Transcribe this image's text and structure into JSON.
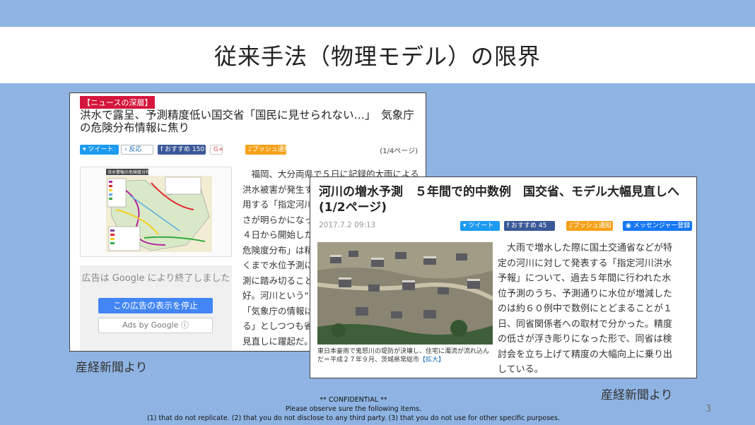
{
  "slide": {
    "title": "従来手法（物理モデル）の限界",
    "page_number": "3"
  },
  "article1": {
    "tag": "【ニュースの深層】",
    "headline": "洪水で露呈、予測精度低い国交省「国民に見せられない…」　気象庁の危険分布情報に焦り",
    "share": {
      "tweet": "ツイート",
      "react": "反応",
      "fb": "おすすめ 150",
      "gplus": "G+",
      "push": "プッシュ通知"
    },
    "page_indicator": "(1/4ページ)",
    "map_label": "洪水警報の危険度分布",
    "ad": {
      "text": "広告は Google により終了しました",
      "stop": "この広告の表示を停止",
      "by": "Ads by Google ⓘ"
    },
    "body": [
      "　福岡、大分両県で５日に記録的大雨による",
      "洪水被害が発生す",
      "用する「指定河川",
      "さが明らかになっ",
      "４日から開始した",
      "危険度分布」は精",
      "くまで水位予測に",
      "測に踏み切ること",
      "好。河川という“聖",
      "「気象庁の情報は",
      "る」としつつも省",
      "見直しに躍起だ。"
    ],
    "source": "産経新聞より"
  },
  "article2": {
    "headline": "河川の増水予測　５年間で的中数例　国交省、モデル大幅見直しへ (1/2ページ)",
    "date": "2017.7.2 09:13",
    "share": {
      "tweet": "ツイート",
      "fb": "おすすめ 45",
      "push": "プッシュ通知",
      "messenger": "メッセンジャー登録"
    },
    "caption": "東日本豪雨で鬼怒川の堤防が決壊し、住宅に濁流が流れ込んだ＝平成２７年９月、茨城県常総市",
    "enlarge": "【拡大】",
    "body": [
      "　大雨で増水した際に国土交通省などが特",
      "定の河川に対して発表する「指定河川洪水",
      "予報」について、過去５年間に行われた水",
      "位予測のうち、予測通りに水位が増減した",
      "のは約６０例中で数例にとどまることが１",
      "日、同省関係者への取材で分かった。精度",
      "の低さが浮き彫りになった形で、同省は検",
      "討会を立ち上げて精度の大幅向上に乗り出",
      "している。"
    ],
    "source": "産経新聞より"
  },
  "footer": {
    "line1": "** CONFIDENTIAL **",
    "line2": "Please observe sure the following items.",
    "line3": "(1) that do not replicate.   (2) that you do not disclose to any third party.   (3) that you do not use for other specific purposes."
  }
}
